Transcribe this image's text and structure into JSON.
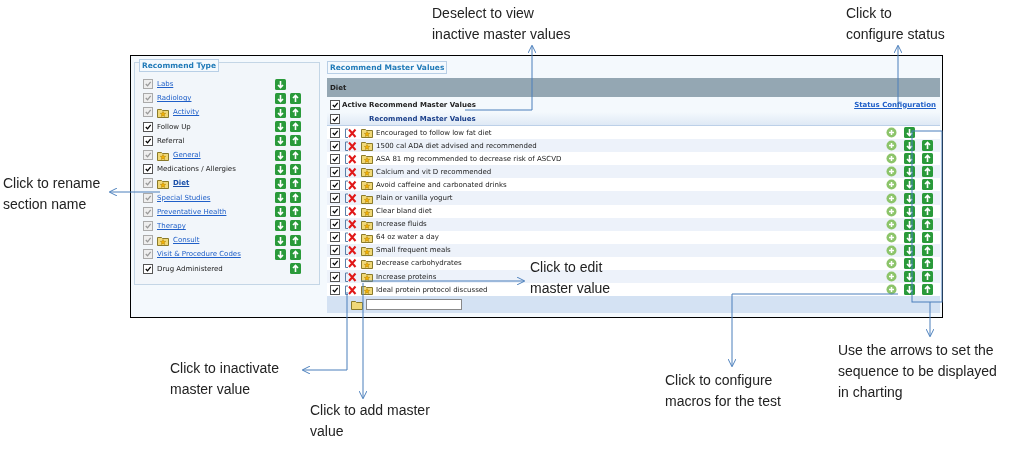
{
  "callouts": [
    {
      "text": "Deselect to view\ninactive master values"
    },
    {
      "text": "Click to\nconfigure status"
    },
    {
      "text": "Click to rename\nsection name"
    },
    {
      "text": "Click to edit\nmaster value"
    },
    {
      "text": "Click to inactivate\nmaster value"
    },
    {
      "text": "Click to add master\nvalue"
    },
    {
      "text": "Click to configure\nmacros for the test"
    },
    {
      "text": "Use the arrows to set the\nsequence to be displayed\nin charting"
    }
  ],
  "recommend_type": {
    "legend": "Recommend Type",
    "items": [
      {
        "label": "Labs",
        "kind": "link",
        "folder": false,
        "selected": false,
        "checked": true,
        "disabled": true,
        "down": true,
        "up": false
      },
      {
        "label": "Radiology",
        "kind": "link",
        "folder": false,
        "selected": false,
        "checked": true,
        "disabled": true,
        "down": true,
        "up": true
      },
      {
        "label": "Activity",
        "kind": "link",
        "folder": true,
        "selected": false,
        "checked": true,
        "disabled": true,
        "down": true,
        "up": true
      },
      {
        "label": "Follow Up",
        "kind": "plain",
        "folder": false,
        "selected": false,
        "checked": true,
        "disabled": false,
        "down": true,
        "up": true
      },
      {
        "label": "Referral",
        "kind": "plain",
        "folder": false,
        "selected": false,
        "checked": true,
        "disabled": false,
        "down": true,
        "up": true
      },
      {
        "label": "General",
        "kind": "link",
        "folder": true,
        "selected": false,
        "checked": true,
        "disabled": true,
        "down": true,
        "up": true
      },
      {
        "label": "Medications / Allergies",
        "kind": "plain",
        "folder": false,
        "selected": false,
        "checked": true,
        "disabled": false,
        "down": true,
        "up": true
      },
      {
        "label": "Diet",
        "kind": "link",
        "folder": true,
        "selected": true,
        "checked": true,
        "disabled": true,
        "down": true,
        "up": true
      },
      {
        "label": "Special Studies",
        "kind": "link",
        "folder": false,
        "selected": false,
        "checked": true,
        "disabled": true,
        "down": true,
        "up": true
      },
      {
        "label": "Preventative Health",
        "kind": "link",
        "folder": false,
        "selected": false,
        "checked": true,
        "disabled": true,
        "down": true,
        "up": true
      },
      {
        "label": "Therapy",
        "kind": "link",
        "folder": false,
        "selected": false,
        "checked": true,
        "disabled": true,
        "down": true,
        "up": true
      },
      {
        "label": "Consult",
        "kind": "link",
        "folder": true,
        "selected": false,
        "checked": true,
        "disabled": true,
        "down": true,
        "up": true
      },
      {
        "label": "Visit & Procedure Codes",
        "kind": "link",
        "folder": false,
        "selected": false,
        "checked": true,
        "disabled": true,
        "down": true,
        "up": true
      },
      {
        "label": "Drug Administered",
        "kind": "plain",
        "folder": false,
        "selected": false,
        "checked": true,
        "disabled": false,
        "down": false,
        "up": true
      }
    ]
  },
  "master_values": {
    "legend": "Recommend Master Values",
    "section": "Diet",
    "active_filter": {
      "label": "Active Recommend Master Values",
      "checked": true
    },
    "status_link": "Status Configuration",
    "header": {
      "label": "Recommend Master Values",
      "checked": true
    },
    "rows": [
      {
        "label": "Encouraged to follow low fat diet",
        "checked": true,
        "down": true,
        "up": false
      },
      {
        "label": "1500 cal ADA diet advised and recommended",
        "checked": true,
        "down": true,
        "up": true
      },
      {
        "label": "ASA 81 mg recommended to decrease risk of ASCVD",
        "checked": true,
        "down": true,
        "up": true
      },
      {
        "label": "Calcium and vit D recommended",
        "checked": true,
        "down": true,
        "up": true
      },
      {
        "label": "Avoid caffeine and carbonated drinks",
        "checked": true,
        "down": true,
        "up": true
      },
      {
        "label": "Plain or vanilla yogurt",
        "checked": true,
        "down": true,
        "up": true
      },
      {
        "label": "Clear bland diet",
        "checked": true,
        "down": true,
        "up": true
      },
      {
        "label": "Increase fluids",
        "checked": true,
        "down": true,
        "up": true
      },
      {
        "label": "64 oz water a day",
        "checked": true,
        "down": true,
        "up": true
      },
      {
        "label": "Small frequent meals",
        "checked": true,
        "down": true,
        "up": true
      },
      {
        "label": "Decrease carbohydrates",
        "checked": true,
        "down": true,
        "up": true
      },
      {
        "label": "Increase proteins",
        "checked": true,
        "down": true,
        "up": true
      },
      {
        "label": "Ideal protein protocol discussed",
        "checked": true,
        "down": true,
        "up": true
      }
    ]
  }
}
